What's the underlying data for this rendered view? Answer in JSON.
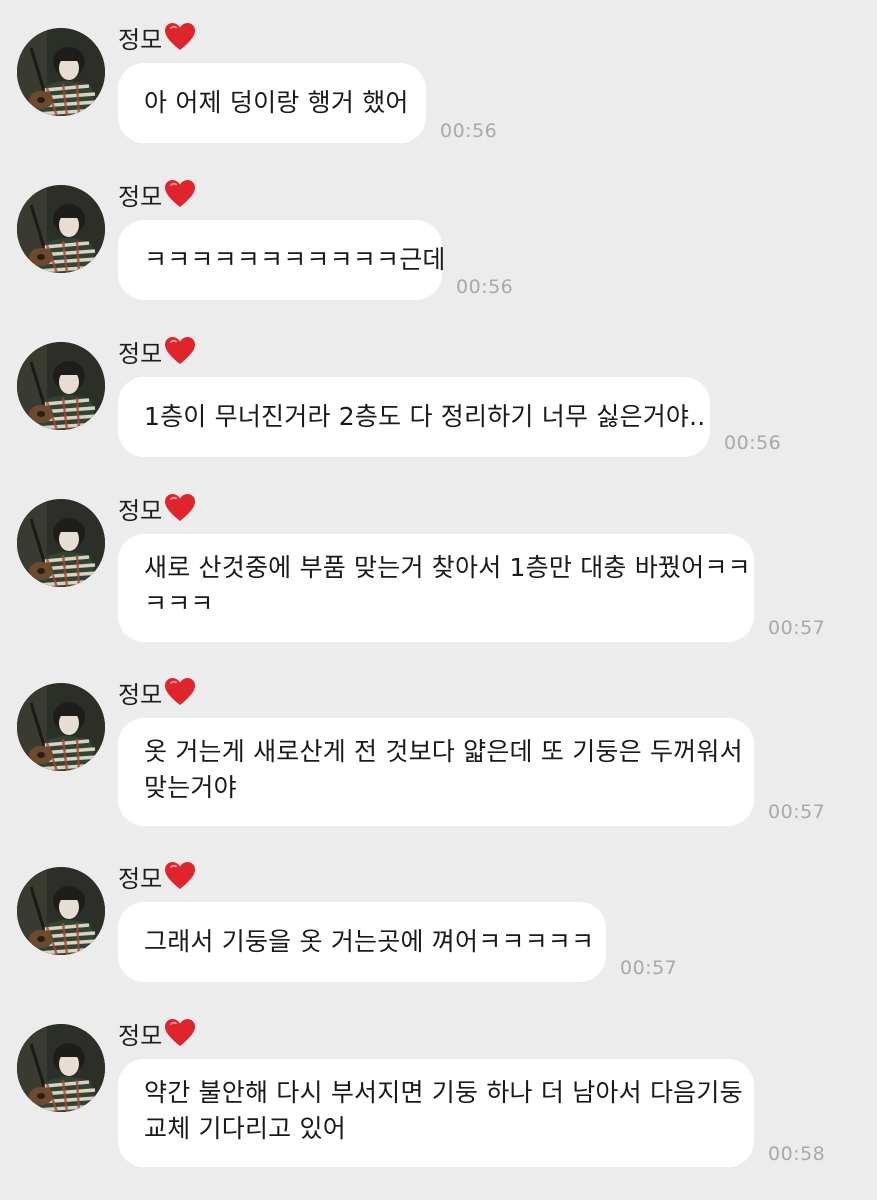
{
  "chat": {
    "messages": [
      {
        "sender": "정모",
        "lines": [
          "아 어제 덩이랑 행거 했어"
        ],
        "time": "00:56"
      },
      {
        "sender": "정모",
        "lines": [
          "ㅋㅋㅋㅋㅋㅋㅋㅋㅋㅋㅋ근데"
        ],
        "time": "00:56"
      },
      {
        "sender": "정모",
        "lines": [
          "1층이 무너진거라 2층도 다 정리하기 너무 싫은거야.."
        ],
        "time": "00:56"
      },
      {
        "sender": "정모",
        "lines": [
          "새로 산것중에 부품 맞는거 찾아서 1층만 대충 바꿨어ㅋㅋ",
          "ㅋㅋㅋ"
        ],
        "time": "00:57"
      },
      {
        "sender": "정모",
        "lines": [
          "옷 거는게 새로산게 전 것보다 얇은데 또 기둥은 두꺼워서",
          "맞는거야"
        ],
        "time": "00:57"
      },
      {
        "sender": "정모",
        "lines": [
          "그래서 기둥을 옷 거는곳에 껴어ㅋㅋㅋㅋㅋ"
        ],
        "time": "00:57"
      },
      {
        "sender": "정모",
        "lines": [
          "약간 불안해 다시 부서지면 기둥 하나 더 남아서 다음기둥",
          "교체 기다리고 있어"
        ],
        "time": "00:58"
      }
    ]
  },
  "colors": {
    "background": "#ececec",
    "bubble": "#ffffff",
    "text": "#1a1a1a",
    "timestamp": "#a9a9a9",
    "heart": "#e0242b"
  },
  "icons": {
    "heart": "heart-icon",
    "avatar": "profile-photo"
  }
}
